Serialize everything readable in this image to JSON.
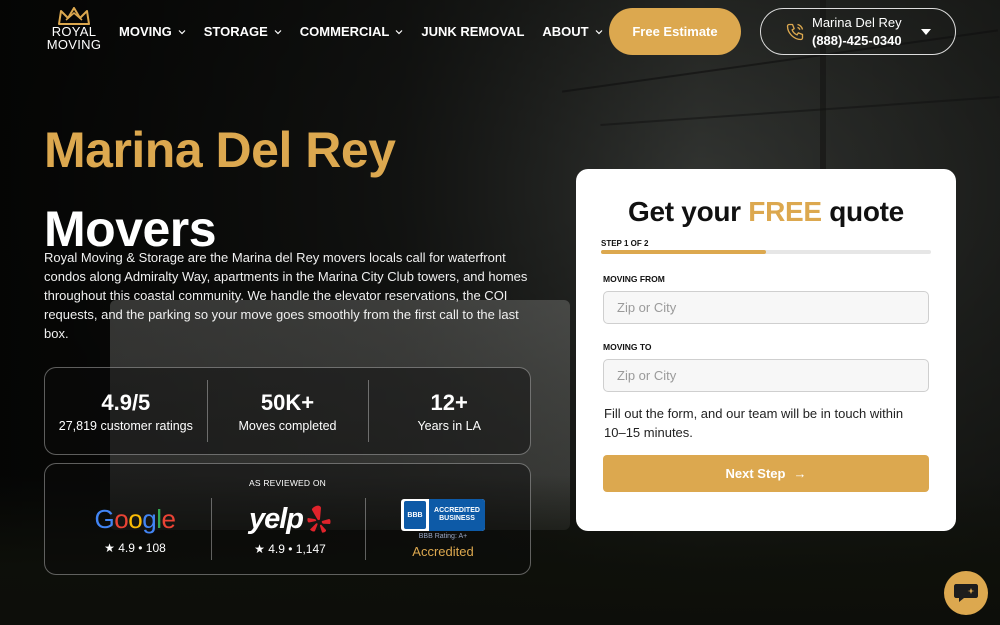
{
  "logo": {
    "line1": "ROYAL",
    "line2": "MOVING"
  },
  "nav": {
    "items": [
      {
        "label": "MOVING",
        "dropdown": true
      },
      {
        "label": "STORAGE",
        "dropdown": true
      },
      {
        "label": "COMMERCIAL",
        "dropdown": true
      },
      {
        "label": "JUNK REMOVAL",
        "dropdown": false
      },
      {
        "label": "ABOUT",
        "dropdown": true
      }
    ]
  },
  "header": {
    "estimate_label": "Free Estimate",
    "phone": {
      "location": "Marina Del Rey",
      "number": "(888)-425-0340",
      "icon": "phone-icon"
    }
  },
  "hero": {
    "title_line1": "Marina Del Rey",
    "title_line2": "Movers",
    "description": "Royal Moving & Storage are the Marina del Rey movers locals call for waterfront condos along Admiralty Way, apartments in the Marina City Club towers, and homes throughout this coastal community. We handle the elevator reservations, the COI requests, and the parking so your move goes smoothly from the first call to the last box."
  },
  "stats": [
    {
      "value": "4.9/5",
      "label": "27,819 customer ratings"
    },
    {
      "value": "50K+",
      "label": "Moves completed"
    },
    {
      "value": "12+",
      "label": "Years in LA"
    }
  ],
  "reviews": {
    "header": "AS REVIEWED ON",
    "google": {
      "name": "Google",
      "rating": "★ 4.9 • 108"
    },
    "yelp": {
      "name": "yelp",
      "rating": "★ 4.9 • 1,147"
    },
    "bbb": {
      "seal": "BBB",
      "badge_line1": "ACCREDITED",
      "badge_line2": "BUSINESS",
      "rating_line": "BBB Rating: A+",
      "status": "Accredited"
    }
  },
  "quote": {
    "title_pre": "Get your ",
    "title_free": "FREE",
    "title_post": " quote",
    "step_label": "STEP 1 OF 2",
    "progress": 0.5,
    "moving_from_label": "MOVING FROM",
    "moving_from_placeholder": "Zip or City",
    "moving_to_label": "MOVING TO",
    "moving_to_placeholder": "Zip or City",
    "note": "Fill out the form, and our team will be in touch within 10–15 minutes.",
    "next_label": "Next Step",
    "next_arrow": "→"
  },
  "colors": {
    "accent": "#dca84f",
    "dark": "#111111",
    "white": "#ffffff"
  },
  "chat": {
    "icon": "chat-icon"
  }
}
